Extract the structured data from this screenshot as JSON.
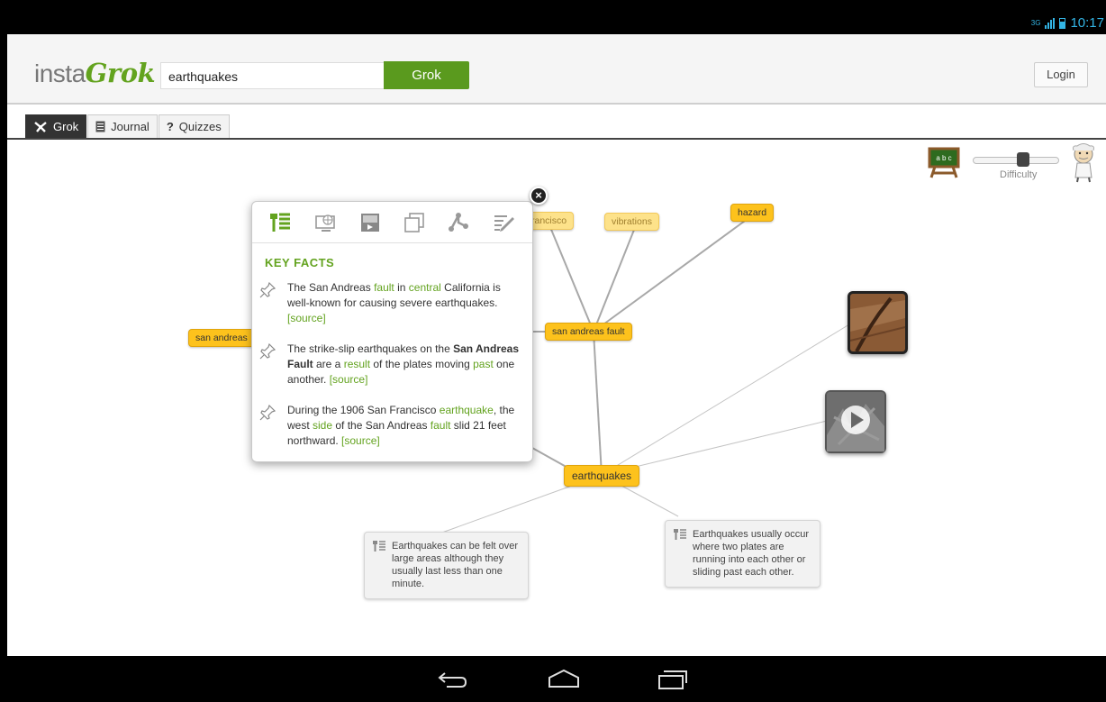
{
  "status": {
    "network": "3G",
    "time": "10:17"
  },
  "header": {
    "logo_prefix": "insta",
    "logo_brand": "Grok",
    "search_value": "earthquakes",
    "grok_button": "Grok",
    "login_button": "Login"
  },
  "tabs": [
    {
      "label": "Grok"
    },
    {
      "label": "Journal"
    },
    {
      "label": "Quizzes"
    }
  ],
  "difficulty": {
    "label": "Difficulty",
    "board_text": "a b c",
    "level": 0.6
  },
  "nodes": {
    "hazard": "hazard",
    "vibrations": "vibrations",
    "san_francisco": "rancisco",
    "san_andreas_fault": "san andreas fault",
    "san_andreas": "san andreas",
    "earthquakes": "earthquakes"
  },
  "fact_cards": [
    "Earthquakes can be felt over large areas although they usually last less than one minute.",
    "Earthquakes usually occur where two plates are running into each other or sliding past each other."
  ],
  "popup": {
    "heading": "KEY FACTS",
    "facts": [
      {
        "parts": [
          "The San Andreas ",
          "fault",
          " in ",
          "central",
          " California is well-known for causing severe earthquakes. ",
          "[source]"
        ]
      },
      {
        "parts": [
          "The strike-slip earthquakes on the ",
          "San Andreas Fault",
          " are a ",
          "result",
          " of the plates moving ",
          "past",
          " one another. ",
          "[source]"
        ]
      },
      {
        "parts": [
          "During the 1906 San Francisco ",
          "earthquake",
          ", the west ",
          "side",
          " of the San Andreas ",
          "fault",
          " slid 21 feet northward. ",
          "[source]"
        ]
      }
    ]
  }
}
